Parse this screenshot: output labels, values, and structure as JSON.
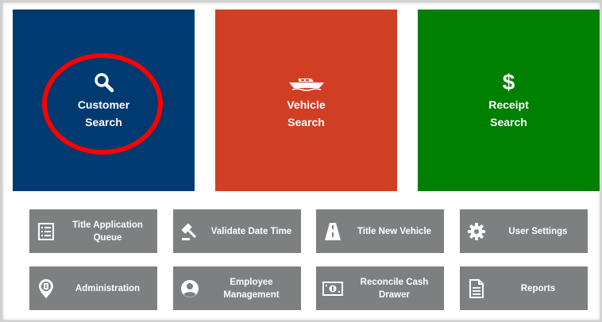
{
  "tiles": {
    "customer": {
      "line1": "Customer",
      "line2": "Search",
      "icon": "search-icon",
      "color": "#003a70"
    },
    "vehicle": {
      "line1": "Vehicle",
      "line2": "Search",
      "icon": "boat-icon",
      "color": "#d03f24"
    },
    "receipt": {
      "line1": "Receipt",
      "line2": "Search",
      "icon": "dollar-icon",
      "glyph": "$",
      "color": "#008000"
    }
  },
  "highlight": {
    "color": "#ff0000"
  },
  "buttons": {
    "title_application_queue": {
      "line1": "Title Application",
      "line2": "Queue",
      "icon": "list-icon"
    },
    "validate_date_time": {
      "label": "Validate Date Time",
      "icon": "gavel-icon"
    },
    "title_new_vehicle": {
      "label": "Title New Vehicle",
      "icon": "road-icon"
    },
    "user_settings": {
      "label": "User Settings",
      "icon": "gear-icon"
    },
    "administration": {
      "label": "Administration",
      "icon": "admin-badge-icon"
    },
    "employee_management": {
      "line1": "Employee",
      "line2": "Management",
      "icon": "user-icon"
    },
    "reconcile_cash_drawer": {
      "line1": "Reconcile Cash",
      "line2": "Drawer",
      "icon": "cash-icon"
    },
    "reports": {
      "label": "Reports",
      "icon": "document-icon"
    }
  },
  "button_color": "#7d7f80"
}
